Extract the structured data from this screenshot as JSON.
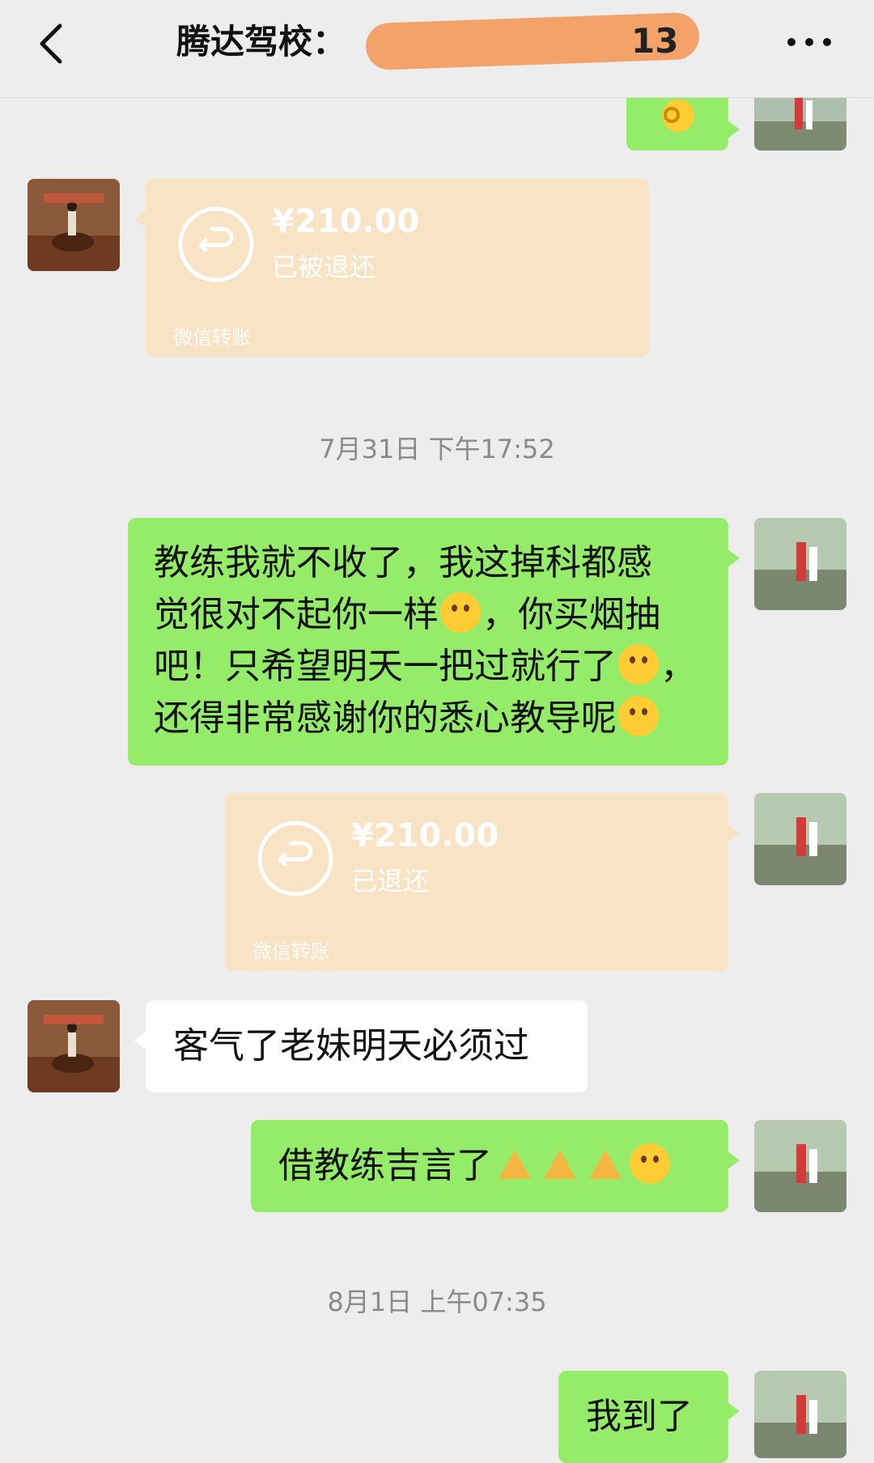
{
  "header": {
    "title": "腾达驾校：",
    "title_partial_visible": "13"
  },
  "messages": {
    "m0": {
      "emoji": "ok-hand-emoji"
    },
    "m1": {
      "amount": "¥210.00",
      "status": "已被退还",
      "footer": "微信转账"
    },
    "ts1": "7月31日 下午17:52",
    "m2": {
      "text": [
        "教练我就不收了，我这掉科都感",
        "觉很对不起你一样",
        "，你买烟抽",
        "吧！只希望明天一把过就行了",
        "，",
        "还得非常感谢你的悉心教导呢"
      ]
    },
    "m3": {
      "amount": "¥210.00",
      "status": "已退还",
      "footer": "微信转账"
    },
    "m4": {
      "text": "客气了老妹明天必须过"
    },
    "m5": {
      "text": "借教练吉言了"
    },
    "ts2": "8月1日 上午07:35",
    "m6": {
      "text": "我到了"
    }
  },
  "colors": {
    "sent_bubble": "#95ec69",
    "received_bubble": "#ffffff",
    "transfer_card": "#f8e3c5",
    "background": "#ededed"
  }
}
